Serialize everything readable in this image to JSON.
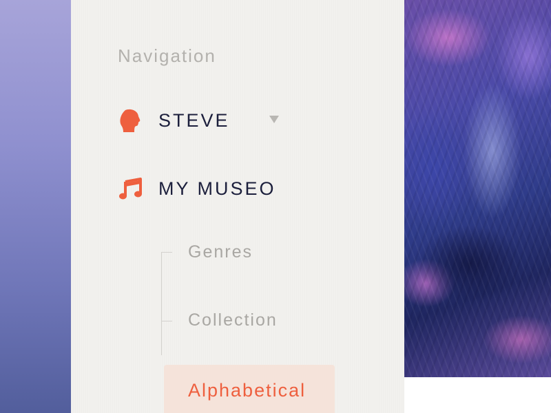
{
  "navigation": {
    "heading": "Navigation",
    "items": [
      {
        "id": "user",
        "label": "STEVE",
        "icon": "user-head-icon",
        "has_dropdown": true
      },
      {
        "id": "museo",
        "label": "MY MUSEO",
        "icon": "music-note-icon"
      }
    ],
    "sub_items": [
      {
        "label": "Genres"
      },
      {
        "label": "Collection"
      },
      {
        "label": "Alphabetical",
        "active": true
      }
    ]
  },
  "colors": {
    "accent": "#ee5f3e",
    "text_dark": "#1c1f3c",
    "text_muted": "#a9a7a3",
    "active_bg": "#f5e3da"
  }
}
